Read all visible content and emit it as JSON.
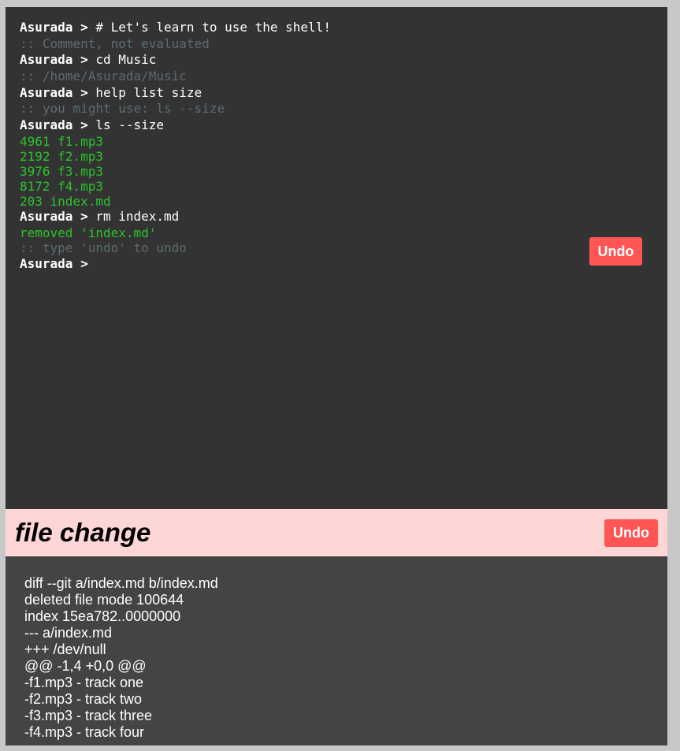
{
  "terminal": {
    "lines": [
      {
        "prompt": "Asurada >",
        "cmd": " # Let's learn to use the shell!"
      },
      {
        "comment": ":: Comment, not evaluated"
      },
      {
        "prompt": "Asurada >",
        "cmd": " cd Music"
      },
      {
        "comment": ":: /home/Asurada/Music"
      },
      {
        "prompt": "Asurada >",
        "cmd": " help list size"
      },
      {
        "comment": ":: you might use: ls --size"
      },
      {
        "prompt": "Asurada >",
        "cmd": " ls --size"
      },
      {
        "output": "4961 f1.mp3"
      },
      {
        "output": "2192 f2.mp3"
      },
      {
        "output": "3976 f3.mp3"
      },
      {
        "output": "8172 f4.mp3"
      },
      {
        "output": "203 index.md"
      },
      {
        "prompt": "Asurada >",
        "cmd": " rm index.md"
      },
      {
        "output": "removed 'index.md'"
      },
      {
        "comment": ":: type 'undo' to undo"
      },
      {
        "prompt": "Asurada >",
        "cmd": ""
      }
    ],
    "undo_label": "Undo"
  },
  "file_change": {
    "title": "file change",
    "undo_label": "Undo"
  },
  "diff": {
    "lines": [
      "diff --git a/index.md b/index.md",
      "deleted file mode 100644",
      "index 15ea782..0000000",
      "--- a/index.md",
      "+++ /dev/null",
      "@@ -1,4 +0,0 @@",
      "-f1.mp3 - track one",
      "-f2.mp3 - track two",
      "-f3.mp3 - track three",
      "-f4.mp3 - track four"
    ]
  },
  "colors": {
    "terminal_bg": "#333333",
    "prompt": "#ffffff",
    "comment": "#5c6b73",
    "output": "#2cc22c",
    "undo_button": "#ff5555",
    "change_header_bg": "#ffd6d6",
    "diff_bg": "#444444"
  }
}
